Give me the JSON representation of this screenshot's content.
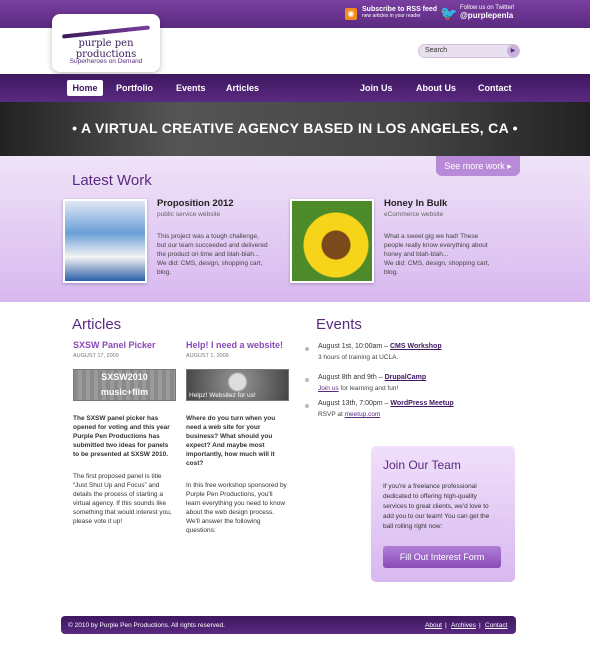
{
  "header": {
    "logo": {
      "name": "purple pen productions",
      "tagline": "Superheroes on Demand"
    },
    "rss": {
      "title": "Subscribe to RSS feed",
      "subtitle": "new articles in your reader"
    },
    "twitter": {
      "line1": "Follow us on Twitter!",
      "handle": "@purplepenla"
    },
    "search": {
      "placeholder": "Search"
    }
  },
  "nav": {
    "items": [
      "Home",
      "Portfolio",
      "Events",
      "Articles",
      "Join Us",
      "About Us",
      "Contact"
    ]
  },
  "banner": {
    "text": "• A VIRTUAL CREATIVE AGENCY BASED IN LOS ANGELES, CA •"
  },
  "latest_work": {
    "title": "Latest Work",
    "see_more": "See more work ▸",
    "projects": [
      {
        "title": "Proposition 2012",
        "subtitle": "public service website",
        "desc1": "This project was a tough challenge,",
        "desc2": "but our team succeeded and delivered",
        "desc3": "the product on time and blah-blah...",
        "desc4": "We did: CMS, design, shopping cart,",
        "desc5": "blog."
      },
      {
        "title": "Honey In Bulk",
        "subtitle": "eCommerce website",
        "desc1": "What a sweet gig we had! These",
        "desc2": "people really know everything about",
        "desc3": "honey and blah-blah...",
        "desc4": "We did: CMS, design, shopping cart,",
        "desc5": "blog."
      }
    ]
  },
  "articles": {
    "title": "Articles",
    "items": [
      {
        "title": "SXSW Panel Picker",
        "date": "AUGUST 17, 2009",
        "image_text1": "SXSW2010",
        "image_text2": "music+film",
        "p1_lines": [
          "The SXSW panel picker has",
          "opened for voting and this year",
          "Purple Pen Productions has",
          "submitted two ideas for panels",
          "to be presented at SXSW 2010."
        ],
        "p2_lines": [
          "The first proposed panel is title",
          "“Just Shut Up and Focus” and",
          "details the process of starting a",
          "virtual agency. If this sounds like",
          "something that would interest you,",
          "please vote it up!"
        ]
      },
      {
        "title": "Help! I need a website!",
        "date": "AUGUST 1, 2009",
        "image_caption": "Helpz! Websitez for us!",
        "p1_lines": [
          "Where do you turn when you",
          "need a web site for your",
          "business? What should you",
          "expect? And maybe most",
          "importantly, how much will it",
          "cost?"
        ],
        "p2_lines": [
          "In this free workshop sponsored by",
          "Purple Pen Productions, you'll",
          "learn everything you need to know",
          "about the web design process.",
          "We'll answer the following",
          "questions:"
        ]
      }
    ]
  },
  "events": {
    "title": "Events",
    "items": [
      {
        "date": "August 1st, 10:00am – ",
        "name": "CMS Workshop",
        "line2_text": "3 hours of training at UCLA.",
        "line2_link": ""
      },
      {
        "date": "August 8th and 9th – ",
        "name": "DrupalCamp",
        "line2_link": "Join us",
        "line2_text": " for learning and fun!"
      },
      {
        "date": "August 13th, 7:00pm – ",
        "name": "WordPress Meetup",
        "line2_text": "RSVP at ",
        "line2_link": "meetup.com"
      }
    ]
  },
  "join_team": {
    "title": "Join Our Team",
    "lines": [
      "If you're a freelance professional",
      "dedicated to offering high-quality",
      "services to great clients, we'd love to",
      "add you to our team! You can get the",
      "ball rolling right now:"
    ],
    "button": "Fill Out Interest Form"
  },
  "footer": {
    "copyright": "© 2010 by Purple Pen Productions. All rights reserved.",
    "links": [
      "About",
      "Archives",
      "Contact"
    ],
    "separator": "|"
  }
}
